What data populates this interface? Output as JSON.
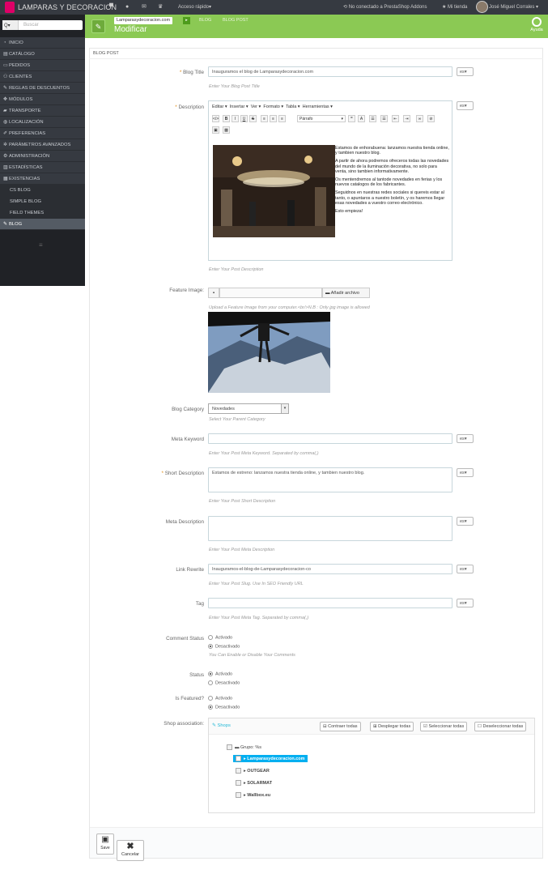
{
  "topbar": {
    "brand": "LAMPARAS Y DECORACION",
    "quick_access": "Acceso rápido",
    "addons_status": "No conectado a PrestaShop Addons",
    "my_store": "Mi tienda",
    "user": "José Miguel Corrales"
  },
  "sidebar": {
    "search_placeholder": "Buscar",
    "items": [
      {
        "label": "INICIO"
      },
      {
        "label": "CATÁLOGO"
      },
      {
        "label": "PEDIDOS"
      },
      {
        "label": "CLIENTES"
      },
      {
        "label": "REGLAS DE DESCUENTOS"
      },
      {
        "label": "MÓDULOS"
      },
      {
        "label": "TRANSPORTE"
      },
      {
        "label": "LOCALIZACIÓN"
      },
      {
        "label": "PREFERENCIAS"
      },
      {
        "label": "PARÁMETROS AVANZADOS"
      },
      {
        "label": "ADMINISTRACIÓN"
      },
      {
        "label": "ESTADÍSTICAS"
      },
      {
        "label": "EXISTENCIAS"
      },
      {
        "label": "CS BLOG"
      },
      {
        "label": "SIMPLE BLOG"
      },
      {
        "label": "FIELD THEMES"
      },
      {
        "label": "BLOG"
      }
    ]
  },
  "toolbar": {
    "shop": "Lamparasydecoracion.com",
    "crumb1": "BLOG",
    "crumb2": "BLOG POST",
    "title": "Modificar",
    "help": "Ayuda"
  },
  "panel": {
    "heading": "BLOG POST",
    "lang": "es",
    "blog_title": {
      "label": "Blog Title",
      "value": "Inauguramos el blog de Lamparasydecoracion.com",
      "help": "Enter Your Blog Post Title"
    },
    "description": {
      "label": "Description",
      "help": "Enter Your Post Description",
      "menu": [
        "Editar",
        "Insertar",
        "Ver",
        "Formato",
        "Tabla",
        "Herramientas"
      ],
      "format_select": "Párrafo",
      "paragraphs": [
        "Estamos de enhorabuena: lanzamos nuestra tienda online,  y tambien nuestro blog.",
        "A partir de ahora podremos ofreceros todas las novedades del mundo de la iluminación decorativa, no solo para venta, sino tambien informativamente.",
        "Os mentendremos al tantode novedades en ferias y los nuevos catalogos de los fabricantes.",
        "Seguidnos en nuestras redes sociales si quereis estar al tanto, o apuntaros a nuestro boletín, y os haremos llegar esas novedades a vuestro correo electrónico.",
        "Esto empieza!"
      ]
    },
    "feature_image": {
      "label": "Feature Image:",
      "add_button": "Añadir archivo",
      "help": "Upload a Feature Image from your computer.<br/>N.B : Only jpg image is allowed"
    },
    "category": {
      "label": "Blog Category",
      "value": "Novedades",
      "help": "Select Your Parent Category"
    },
    "meta_keyword": {
      "label": "Meta Keyword",
      "value": "",
      "help": "Enter Your Post Meta Keyword. Separated by comma(,)"
    },
    "short_description": {
      "label": "Short Description",
      "value": "Estamos de estreno: lanzamos nuestra tienda online,  y tambien nuestro blog.",
      "help": "Enter Your Post Short Description"
    },
    "meta_description": {
      "label": "Meta Description",
      "value": "",
      "help": "Enter Your Post Meta Description"
    },
    "link_rewrite": {
      "label": "Link Rewrite",
      "value": "Inauguramos-el-blog-de-Lamparasydecoracion-co",
      "help": "Enter Your Post Slug. Use In SEO Friendly URL"
    },
    "tag": {
      "label": "Tag",
      "value": "",
      "help": "Enter Your Post Meta Tag. Separated by comma(,)"
    },
    "comment_status": {
      "label": "Comment Status",
      "on": "Activado",
      "off": "Desactivado",
      "help": "You Can Enable or Disable Your Comments"
    },
    "status": {
      "label": "Status",
      "on": "Activado",
      "off": "Desactivado"
    },
    "featured": {
      "label": "Is Featured?",
      "on": "Activado",
      "off": "Desactivado"
    },
    "shop_association": {
      "label": "Shop association:",
      "tab": "Shops",
      "collapse": "Contraer todas",
      "expand": "Desplegar todas",
      "select_all": "Seleccionar todas",
      "deselect_all": "Deseleccionar todas",
      "group": "Grupo: %s",
      "shops": [
        "Lamparasydecoracion.com",
        "OUTGEAR",
        "SOLARMAT",
        "Wallbox.eu"
      ]
    },
    "save": "Save",
    "cancel": "Cancelar"
  }
}
